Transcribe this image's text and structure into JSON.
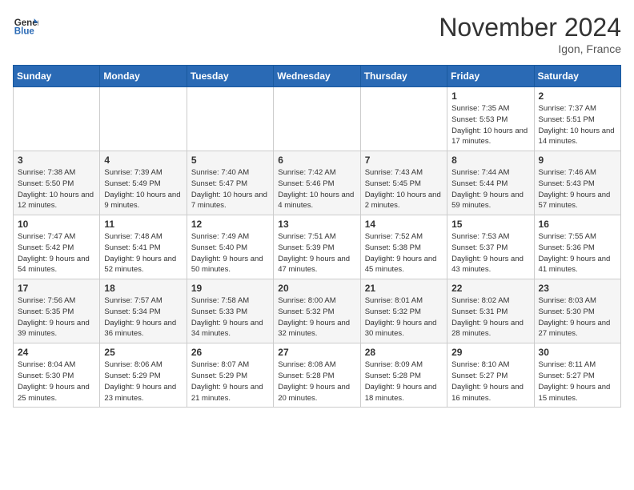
{
  "header": {
    "logo_line1": "General",
    "logo_line2": "Blue",
    "month": "November 2024",
    "location": "Igon, France"
  },
  "days_of_week": [
    "Sunday",
    "Monday",
    "Tuesday",
    "Wednesday",
    "Thursday",
    "Friday",
    "Saturday"
  ],
  "weeks": [
    {
      "days": [
        {
          "num": "",
          "info": "",
          "empty": true
        },
        {
          "num": "",
          "info": "",
          "empty": true
        },
        {
          "num": "",
          "info": "",
          "empty": true
        },
        {
          "num": "",
          "info": "",
          "empty": true
        },
        {
          "num": "",
          "info": "",
          "empty": true
        },
        {
          "num": "1",
          "info": "Sunrise: 7:35 AM\nSunset: 5:53 PM\nDaylight: 10 hours\nand 17 minutes."
        },
        {
          "num": "2",
          "info": "Sunrise: 7:37 AM\nSunset: 5:51 PM\nDaylight: 10 hours\nand 14 minutes."
        }
      ]
    },
    {
      "days": [
        {
          "num": "3",
          "info": "Sunrise: 7:38 AM\nSunset: 5:50 PM\nDaylight: 10 hours\nand 12 minutes."
        },
        {
          "num": "4",
          "info": "Sunrise: 7:39 AM\nSunset: 5:49 PM\nDaylight: 10 hours\nand 9 minutes."
        },
        {
          "num": "5",
          "info": "Sunrise: 7:40 AM\nSunset: 5:47 PM\nDaylight: 10 hours\nand 7 minutes."
        },
        {
          "num": "6",
          "info": "Sunrise: 7:42 AM\nSunset: 5:46 PM\nDaylight: 10 hours\nand 4 minutes."
        },
        {
          "num": "7",
          "info": "Sunrise: 7:43 AM\nSunset: 5:45 PM\nDaylight: 10 hours\nand 2 minutes."
        },
        {
          "num": "8",
          "info": "Sunrise: 7:44 AM\nSunset: 5:44 PM\nDaylight: 9 hours\nand 59 minutes."
        },
        {
          "num": "9",
          "info": "Sunrise: 7:46 AM\nSunset: 5:43 PM\nDaylight: 9 hours\nand 57 minutes."
        }
      ]
    },
    {
      "days": [
        {
          "num": "10",
          "info": "Sunrise: 7:47 AM\nSunset: 5:42 PM\nDaylight: 9 hours\nand 54 minutes."
        },
        {
          "num": "11",
          "info": "Sunrise: 7:48 AM\nSunset: 5:41 PM\nDaylight: 9 hours\nand 52 minutes."
        },
        {
          "num": "12",
          "info": "Sunrise: 7:49 AM\nSunset: 5:40 PM\nDaylight: 9 hours\nand 50 minutes."
        },
        {
          "num": "13",
          "info": "Sunrise: 7:51 AM\nSunset: 5:39 PM\nDaylight: 9 hours\nand 47 minutes."
        },
        {
          "num": "14",
          "info": "Sunrise: 7:52 AM\nSunset: 5:38 PM\nDaylight: 9 hours\nand 45 minutes."
        },
        {
          "num": "15",
          "info": "Sunrise: 7:53 AM\nSunset: 5:37 PM\nDaylight: 9 hours\nand 43 minutes."
        },
        {
          "num": "16",
          "info": "Sunrise: 7:55 AM\nSunset: 5:36 PM\nDaylight: 9 hours\nand 41 minutes."
        }
      ]
    },
    {
      "days": [
        {
          "num": "17",
          "info": "Sunrise: 7:56 AM\nSunset: 5:35 PM\nDaylight: 9 hours\nand 39 minutes."
        },
        {
          "num": "18",
          "info": "Sunrise: 7:57 AM\nSunset: 5:34 PM\nDaylight: 9 hours\nand 36 minutes."
        },
        {
          "num": "19",
          "info": "Sunrise: 7:58 AM\nSunset: 5:33 PM\nDaylight: 9 hours\nand 34 minutes."
        },
        {
          "num": "20",
          "info": "Sunrise: 8:00 AM\nSunset: 5:32 PM\nDaylight: 9 hours\nand 32 minutes."
        },
        {
          "num": "21",
          "info": "Sunrise: 8:01 AM\nSunset: 5:32 PM\nDaylight: 9 hours\nand 30 minutes."
        },
        {
          "num": "22",
          "info": "Sunrise: 8:02 AM\nSunset: 5:31 PM\nDaylight: 9 hours\nand 28 minutes."
        },
        {
          "num": "23",
          "info": "Sunrise: 8:03 AM\nSunset: 5:30 PM\nDaylight: 9 hours\nand 27 minutes."
        }
      ]
    },
    {
      "days": [
        {
          "num": "24",
          "info": "Sunrise: 8:04 AM\nSunset: 5:30 PM\nDaylight: 9 hours\nand 25 minutes."
        },
        {
          "num": "25",
          "info": "Sunrise: 8:06 AM\nSunset: 5:29 PM\nDaylight: 9 hours\nand 23 minutes."
        },
        {
          "num": "26",
          "info": "Sunrise: 8:07 AM\nSunset: 5:29 PM\nDaylight: 9 hours\nand 21 minutes."
        },
        {
          "num": "27",
          "info": "Sunrise: 8:08 AM\nSunset: 5:28 PM\nDaylight: 9 hours\nand 20 minutes."
        },
        {
          "num": "28",
          "info": "Sunrise: 8:09 AM\nSunset: 5:28 PM\nDaylight: 9 hours\nand 18 minutes."
        },
        {
          "num": "29",
          "info": "Sunrise: 8:10 AM\nSunset: 5:27 PM\nDaylight: 9 hours\nand 16 minutes."
        },
        {
          "num": "30",
          "info": "Sunrise: 8:11 AM\nSunset: 5:27 PM\nDaylight: 9 hours\nand 15 minutes."
        }
      ]
    }
  ]
}
